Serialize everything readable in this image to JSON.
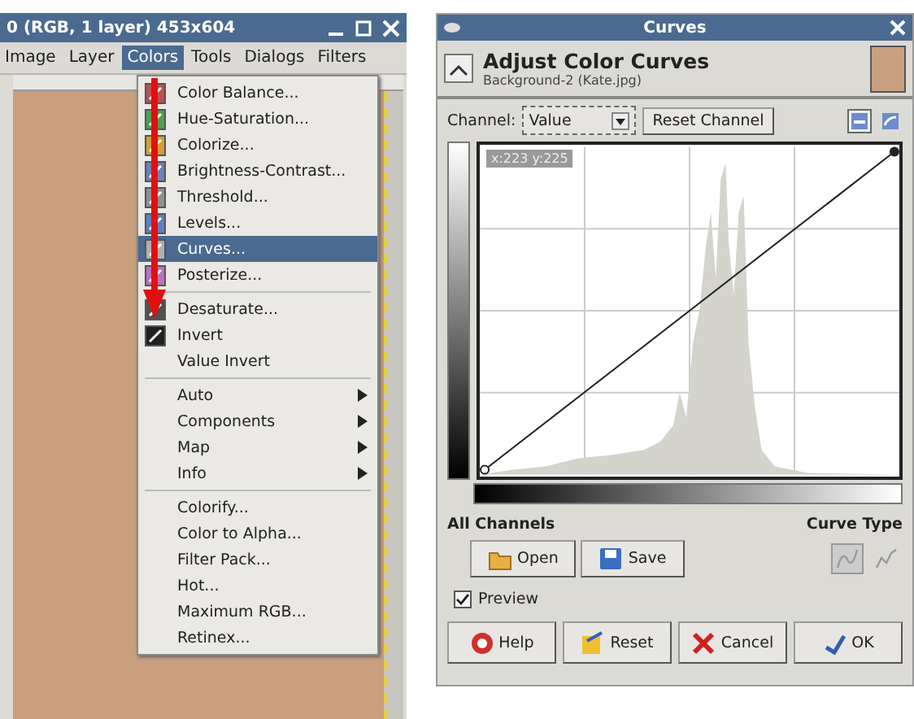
{
  "image_window": {
    "title": "0 (RGB, 1 layer) 453x604",
    "menubar": [
      {
        "label": "Image",
        "selected": false
      },
      {
        "label": "Layer",
        "selected": false
      },
      {
        "label": "Colors",
        "selected": true
      },
      {
        "label": "Tools",
        "selected": false
      },
      {
        "label": "Dialogs",
        "selected": false
      },
      {
        "label": "Filters",
        "selected": false
      }
    ],
    "colors_menu": {
      "groups": [
        [
          {
            "label": "Color Balance...",
            "kind": "icon",
            "selected": false,
            "submenu": false
          },
          {
            "label": "Hue-Saturation...",
            "kind": "icon",
            "selected": false,
            "submenu": false
          },
          {
            "label": "Colorize...",
            "kind": "icon",
            "selected": false,
            "submenu": false
          },
          {
            "label": "Brightness-Contrast...",
            "kind": "icon",
            "selected": false,
            "submenu": false
          },
          {
            "label": "Threshold...",
            "kind": "icon",
            "selected": false,
            "submenu": false
          },
          {
            "label": "Levels...",
            "kind": "icon",
            "selected": false,
            "submenu": false
          },
          {
            "label": "Curves...",
            "kind": "icon",
            "selected": true,
            "submenu": false
          },
          {
            "label": "Posterize...",
            "kind": "icon",
            "selected": false,
            "submenu": false
          }
        ],
        [
          {
            "label": "Desaturate...",
            "kind": "icon",
            "selected": false,
            "submenu": false
          },
          {
            "label": "Invert",
            "kind": "icon",
            "selected": false,
            "submenu": false
          },
          {
            "label": "Value Invert",
            "kind": "plain",
            "selected": false,
            "submenu": false
          }
        ],
        [
          {
            "label": "Auto",
            "kind": "plain",
            "selected": false,
            "submenu": true
          },
          {
            "label": "Components",
            "kind": "plain",
            "selected": false,
            "submenu": true
          },
          {
            "label": "Map",
            "kind": "plain",
            "selected": false,
            "submenu": true
          },
          {
            "label": "Info",
            "kind": "plain",
            "selected": false,
            "submenu": true
          }
        ],
        [
          {
            "label": "Colorify...",
            "kind": "plain",
            "selected": false,
            "submenu": false
          },
          {
            "label": "Color to Alpha...",
            "kind": "plain",
            "selected": false,
            "submenu": false
          },
          {
            "label": "Filter Pack...",
            "kind": "plain",
            "selected": false,
            "submenu": false
          },
          {
            "label": "Hot...",
            "kind": "plain",
            "selected": false,
            "submenu": false
          },
          {
            "label": "Maximum RGB...",
            "kind": "plain",
            "selected": false,
            "submenu": false
          },
          {
            "label": "Retinex...",
            "kind": "plain",
            "selected": false,
            "submenu": false
          }
        ]
      ]
    }
  },
  "curves_dialog": {
    "title": "Curves",
    "heading": "Adjust Color Curves",
    "subtitle": "Background-2 (Kate.jpg)",
    "channel_label": "Channel:",
    "channel_value": "Value",
    "reset_channel_button": "Reset Channel",
    "histogram_scale": [
      {
        "kind": "linear",
        "selected": true
      },
      {
        "kind": "log",
        "selected": false
      }
    ],
    "cursor_readout": "x:223 y:225",
    "all_channels_label": "All Channels",
    "curve_type_label": "Curve Type",
    "file_buttons": [
      {
        "kind": "open",
        "label": "Open"
      },
      {
        "kind": "save",
        "label": "Save"
      }
    ],
    "curve_types": [
      {
        "kind": "smooth",
        "selected": true
      },
      {
        "kind": "freehand",
        "selected": false
      }
    ],
    "preview": {
      "label": "Preview",
      "checked": true
    },
    "buttons": [
      {
        "kind": "help",
        "label": "Help"
      },
      {
        "kind": "reset",
        "label": "Reset"
      },
      {
        "kind": "cancel",
        "label": "Cancel"
      },
      {
        "kind": "ok",
        "label": "OK"
      }
    ]
  }
}
